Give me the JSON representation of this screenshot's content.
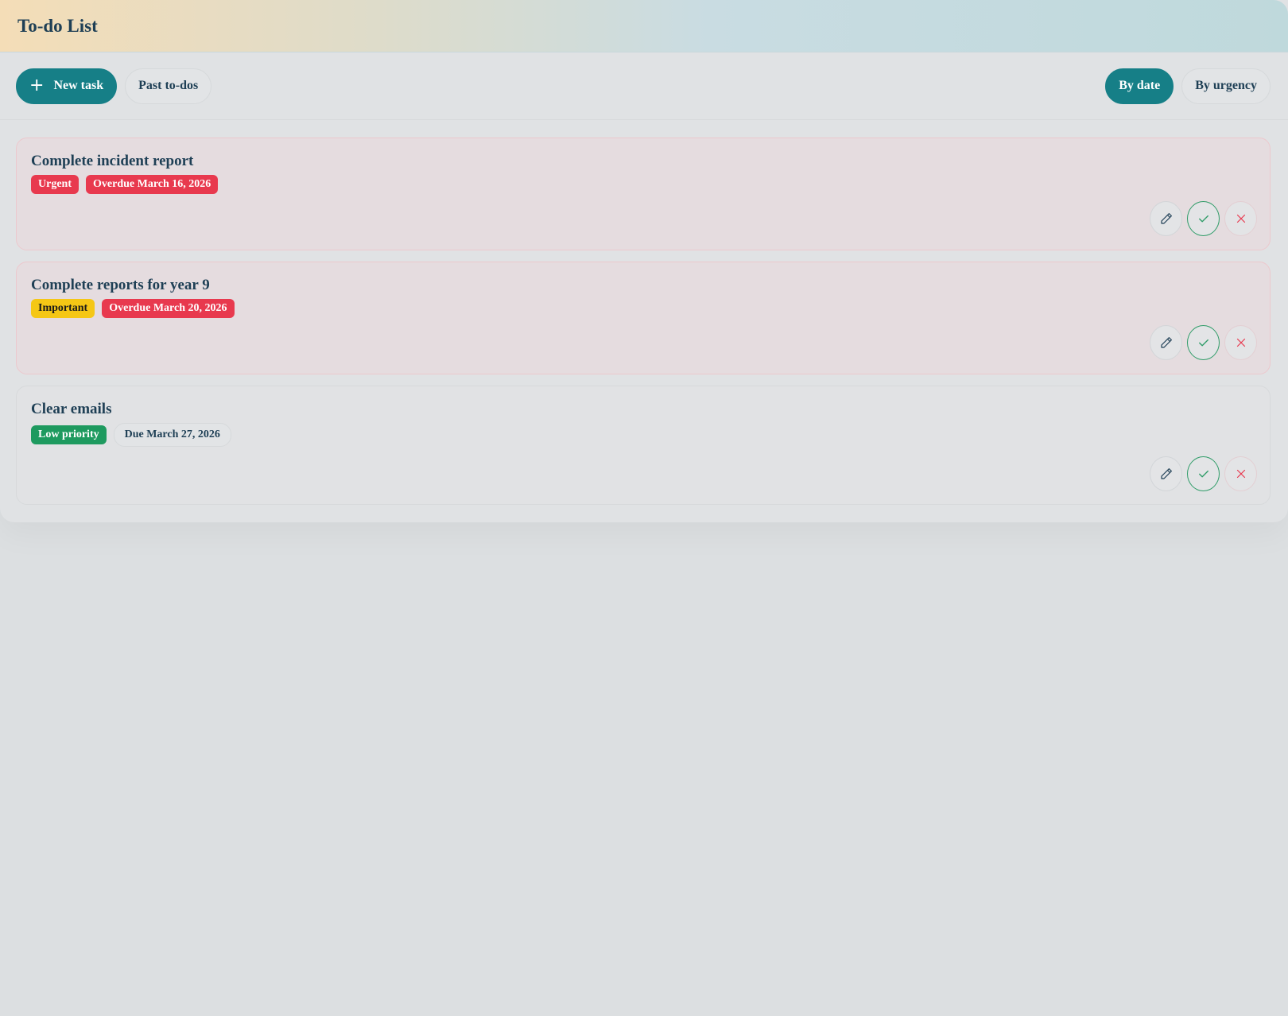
{
  "header": {
    "title": "To-do List"
  },
  "toolbar": {
    "new_task_label": "New task",
    "past_todos_label": "Past to-dos",
    "sort_by_date_label": "By date",
    "sort_by_urgency_label": "By urgency"
  },
  "tasks": [
    {
      "title": "Complete incident report",
      "priority": "Urgent",
      "due": "Overdue March 16, 2026",
      "status": "overdue"
    },
    {
      "title": "Complete reports for year 9",
      "priority": "Important",
      "due": "Overdue March 20, 2026",
      "status": "overdue"
    },
    {
      "title": "Clear emails",
      "priority": "Low priority",
      "due": "Due March 27, 2026",
      "status": "upcoming"
    }
  ],
  "icons": {
    "add": "plus-icon",
    "edit": "pencil-icon",
    "complete": "check-icon",
    "delete": "close-icon"
  },
  "colors": {
    "accent": "#167f87",
    "urgent": "#e8394e",
    "important": "#f5c715",
    "low": "#1e9a5f",
    "text": "#1e3f55"
  }
}
